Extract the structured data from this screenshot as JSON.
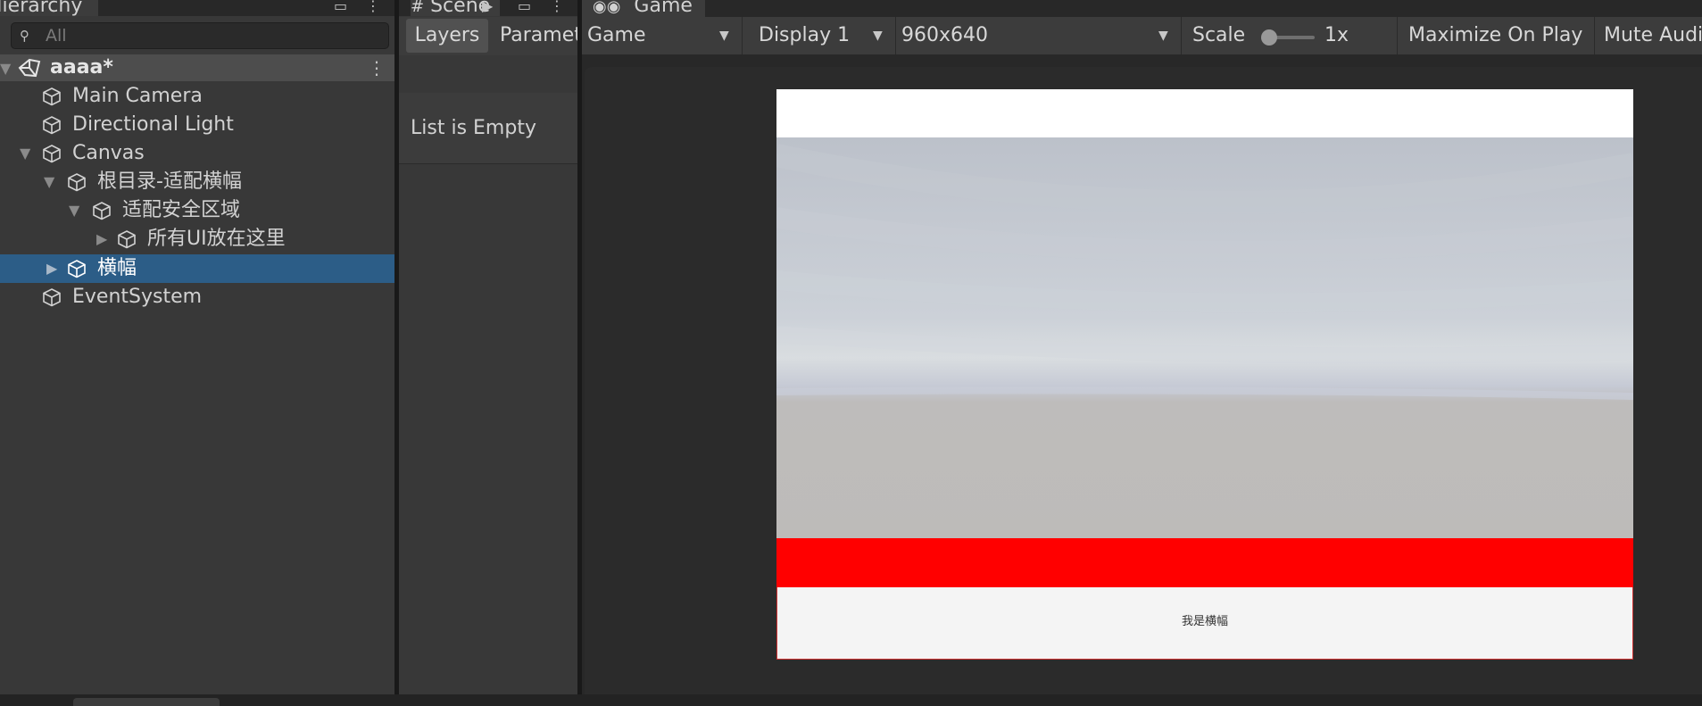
{
  "hierarchy": {
    "tab_label": "Hierarchy",
    "search_placeholder": "All",
    "scene": {
      "name": "aaaa*"
    },
    "items": [
      {
        "label": "Main Camera"
      },
      {
        "label": "Directional Light"
      },
      {
        "label": "Canvas"
      },
      {
        "label": "根目录-适配横幅"
      },
      {
        "label": "适配安全区域"
      },
      {
        "label": "所有UI放在这里"
      },
      {
        "label": "横幅",
        "selected": true
      },
      {
        "label": "EventSystem"
      }
    ]
  },
  "animator": {
    "tab_label": "Scene",
    "layers_label": "Layers",
    "parameters_label": "Parameters",
    "empty_text": "List is Empty"
  },
  "game": {
    "tab_label": "Game",
    "mode_dropdown": "Game",
    "display_dropdown": "Display 1",
    "resolution_dropdown": "960x640",
    "scale_label": "Scale",
    "scale_value": "1x",
    "scale_level": 0.0,
    "maximize_label": "Maximize On Play",
    "mute_label": "Mute Audio",
    "banner_text": "我是横幅"
  },
  "colors": {
    "selection": "#2c5d87",
    "banner_red": "#ff0000",
    "panel": "#383838",
    "toolbar": "#3c3c3c"
  }
}
